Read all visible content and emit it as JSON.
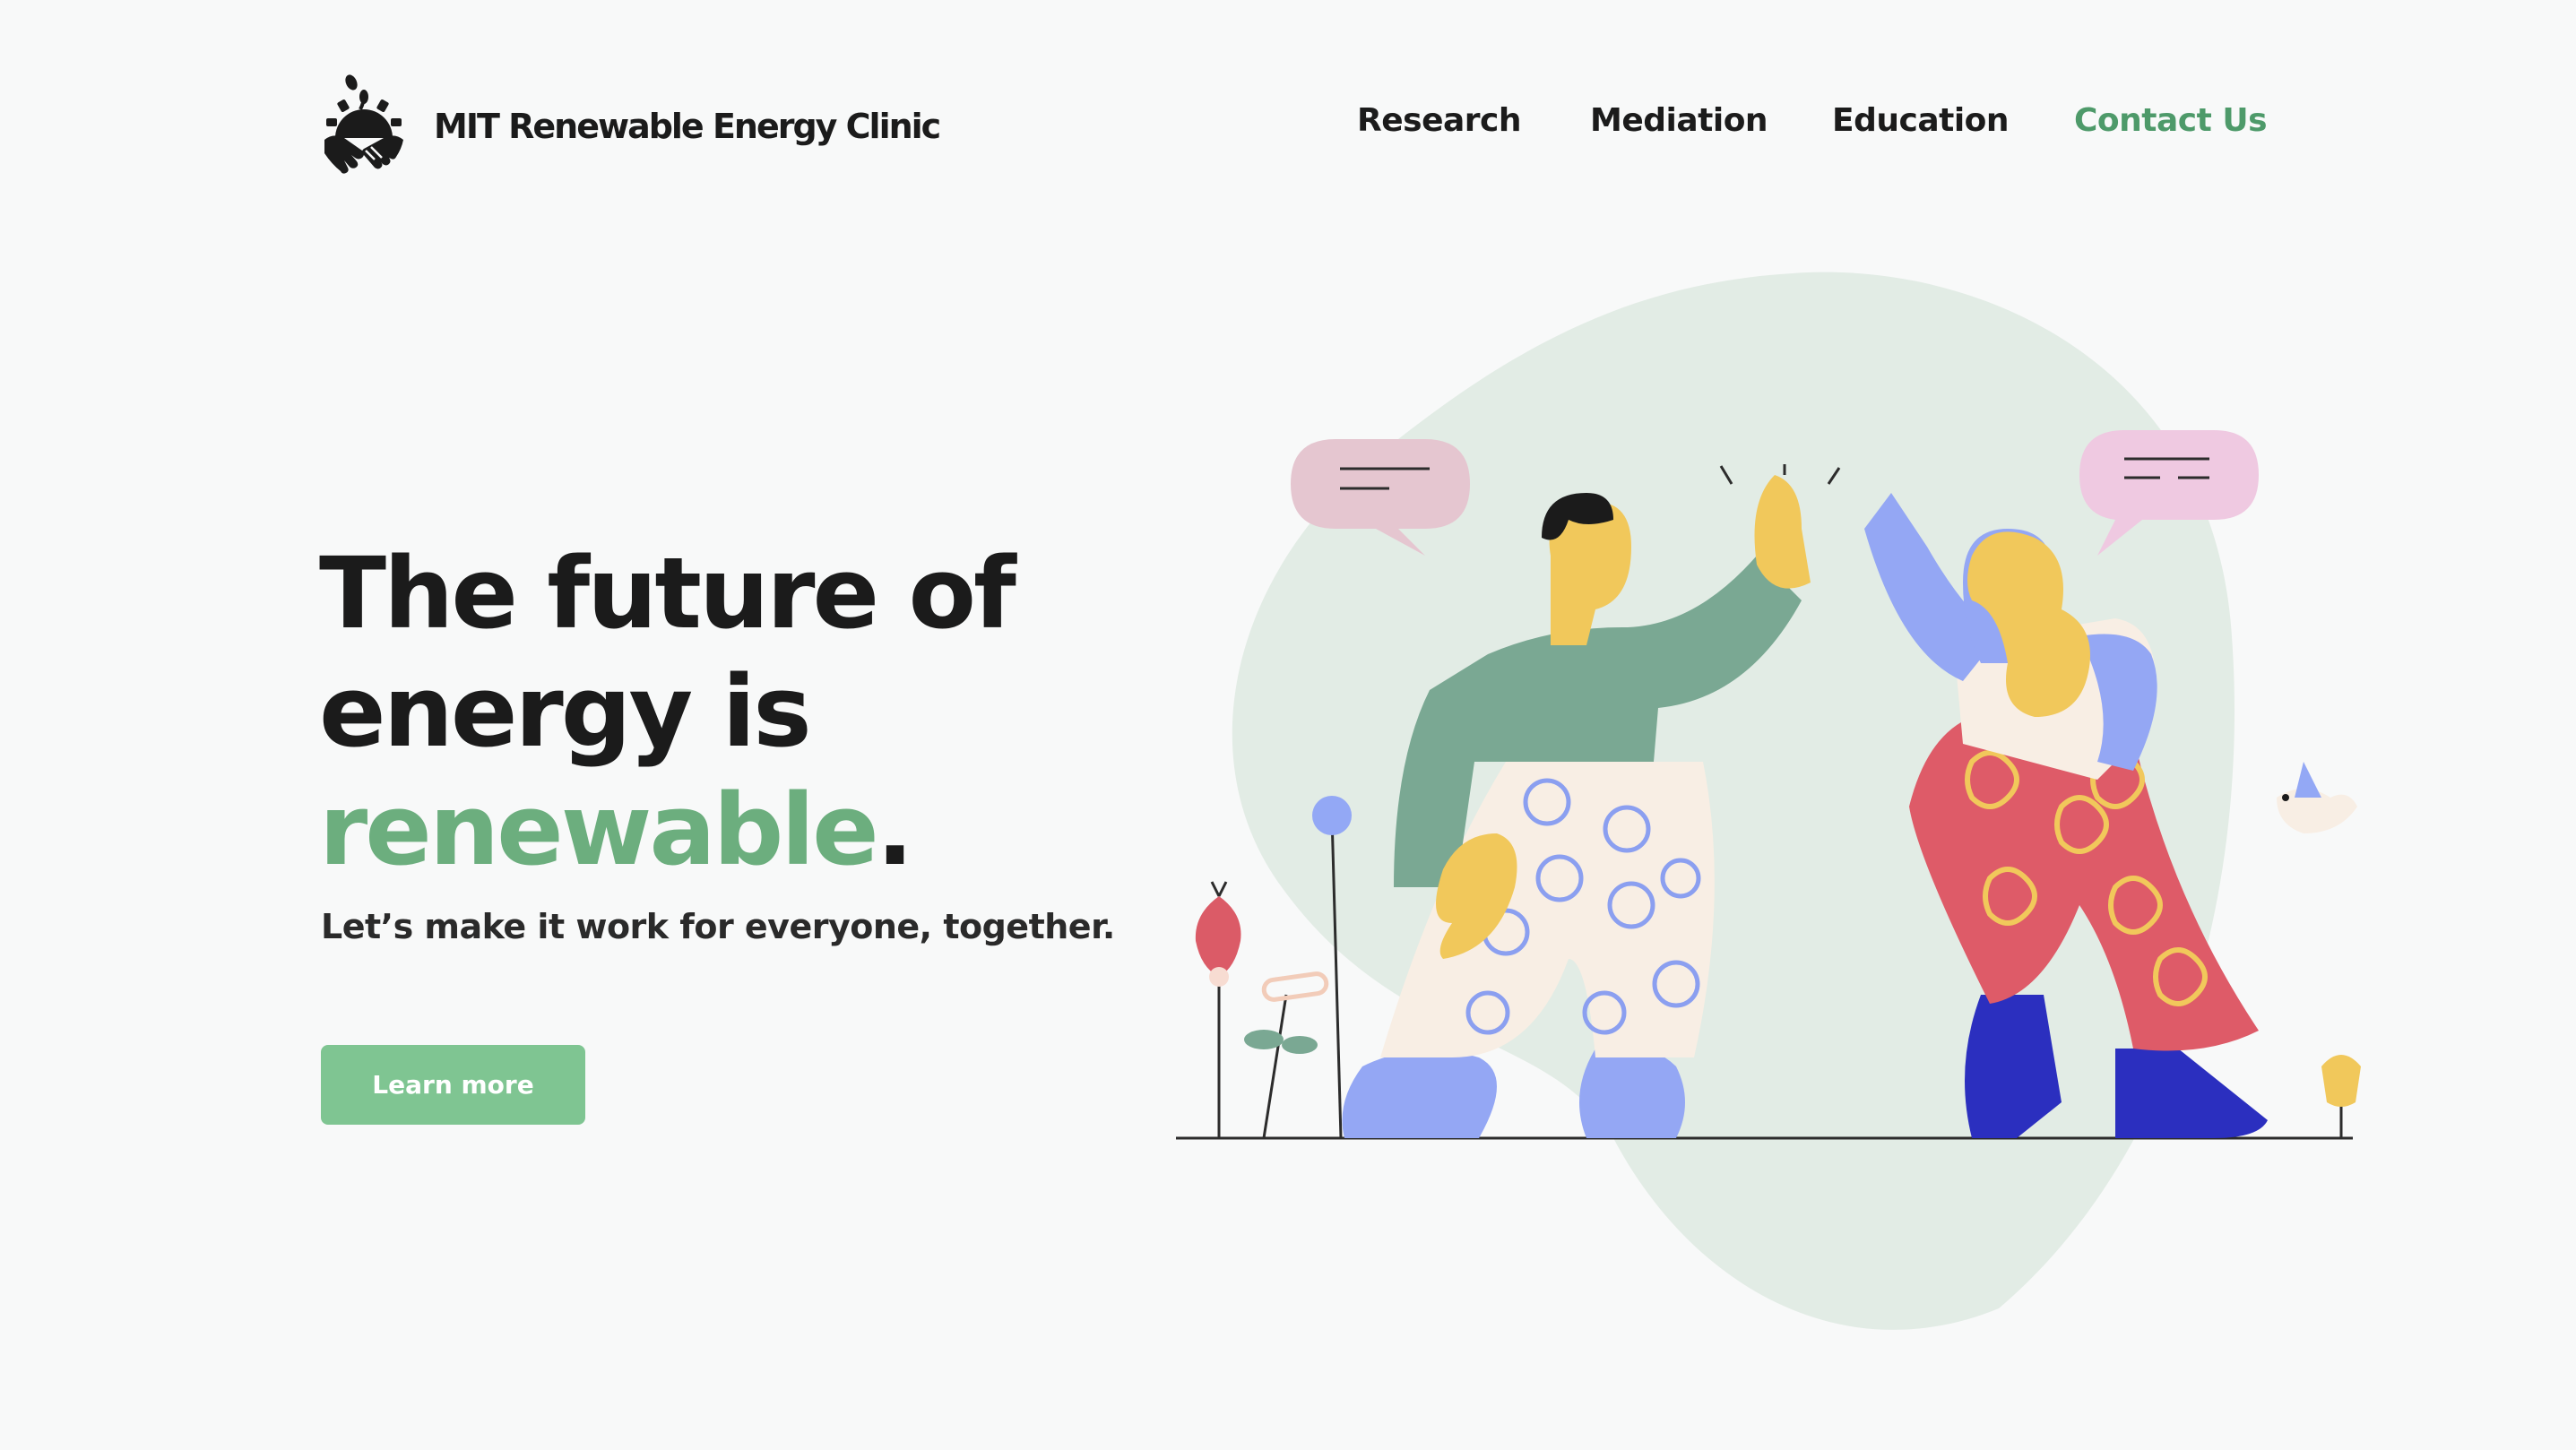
{
  "brand": {
    "name": "MIT Renewable Energy Clinic"
  },
  "nav": {
    "items": [
      {
        "label": "Research"
      },
      {
        "label": "Mediation"
      },
      {
        "label": "Education"
      },
      {
        "label": "Contact Us"
      }
    ]
  },
  "hero": {
    "headline_line1": "The future of",
    "headline_line2": "energy is",
    "headline_accent": "renewable",
    "headline_period": ".",
    "subtitle": "Let’s make it work for everyone, together.",
    "cta_label": "Learn more"
  },
  "colors": {
    "accent_green": "#4e9a6a",
    "headline_green": "#6cae7e",
    "button_green": "#7fc592",
    "blob": "#e2ece5"
  },
  "icons": {
    "logo": "handshake-sun-logo-icon"
  }
}
